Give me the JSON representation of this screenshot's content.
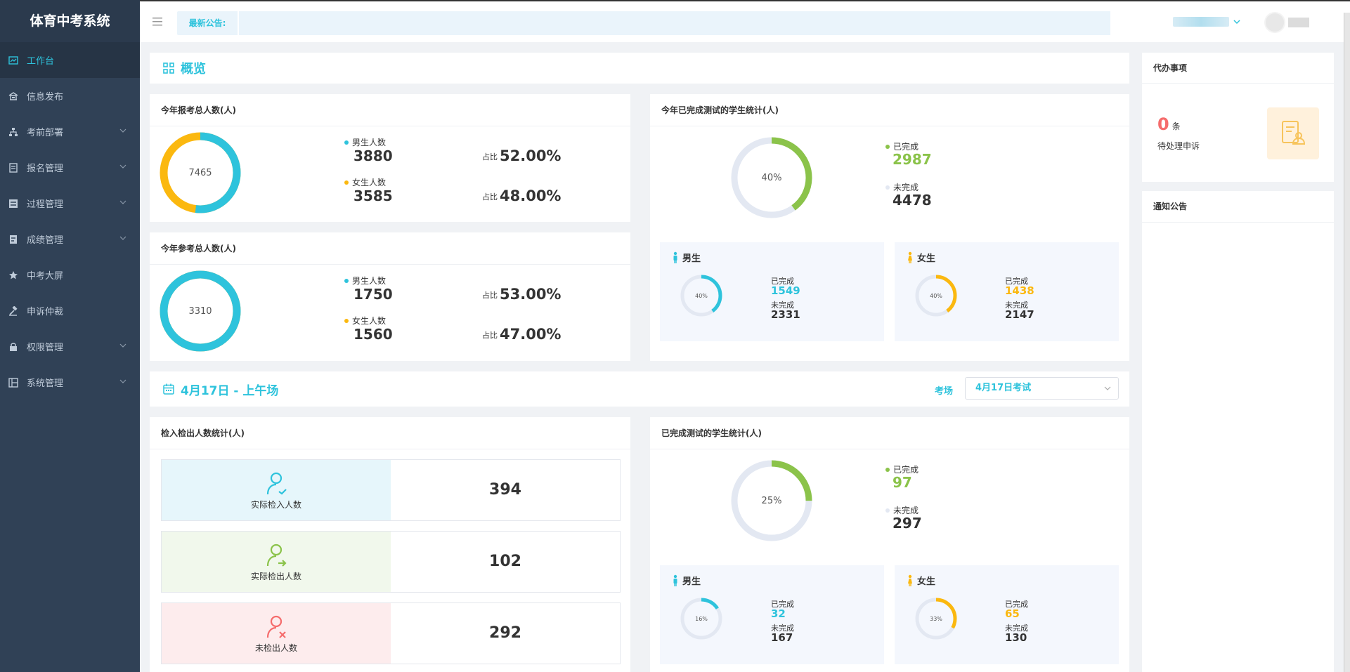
{
  "app": {
    "title": "体育中考系统"
  },
  "sidebar": {
    "items": [
      {
        "label": "工作台",
        "icon": "dashboard-icon",
        "active": true,
        "expandable": false
      },
      {
        "label": "信息发布",
        "icon": "building-icon",
        "active": false,
        "expandable": false
      },
      {
        "label": "考前部署",
        "icon": "sitemap-icon",
        "active": false,
        "expandable": true
      },
      {
        "label": "报名管理",
        "icon": "document-icon",
        "active": false,
        "expandable": true
      },
      {
        "label": "过程管理",
        "icon": "list-icon",
        "active": false,
        "expandable": true
      },
      {
        "label": "成绩管理",
        "icon": "score-icon",
        "active": false,
        "expandable": true
      },
      {
        "label": "中考大屏",
        "icon": "star-icon",
        "active": false,
        "expandable": false
      },
      {
        "label": "申诉仲裁",
        "icon": "gavel-icon",
        "active": false,
        "expandable": false
      },
      {
        "label": "权限管理",
        "icon": "lock-icon",
        "active": false,
        "expandable": true
      },
      {
        "label": "系统管理",
        "icon": "grid-icon",
        "active": false,
        "expandable": true
      }
    ]
  },
  "topbar": {
    "notice_label": "最新公告:",
    "notice_value": ""
  },
  "overview": {
    "title": "概览"
  },
  "registered": {
    "title": "今年报考总人数(人)",
    "total": "7465",
    "male_label": "男生人数",
    "male_value": "3880",
    "female_label": "女生人数",
    "female_value": "3585",
    "ratio_label": "占比",
    "male_ratio": "52.00%",
    "female_ratio": "48.00%",
    "male_fraction": 0.52
  },
  "participating": {
    "title": "今年参考总人数(人)",
    "total": "3310",
    "male_label": "男生人数",
    "male_value": "1750",
    "female_label": "女生人数",
    "female_value": "1560",
    "ratio_label": "占比",
    "male_ratio": "53.00%",
    "female_ratio": "47.00%",
    "male_fraction": 1.0
  },
  "year_completed": {
    "title": "今年已完成测试的学生统计(人)",
    "percent_label": "40%",
    "fraction": 0.4,
    "done_label": "已完成",
    "done_value": "2987",
    "undone_label": "未完成",
    "undone_value": "4478",
    "male": {
      "title": "男生",
      "percent_label": "40%",
      "fraction": 0.4,
      "done_label": "已完成",
      "done_value": "1549",
      "undone_label": "未完成",
      "undone_value": "2331"
    },
    "female": {
      "title": "女生",
      "percent_label": "40%",
      "fraction": 0.4,
      "done_label": "已完成",
      "done_value": "1438",
      "undone_label": "未完成",
      "undone_value": "2147"
    }
  },
  "session": {
    "title": "4月17日 - 上午场",
    "venue_label": "考场",
    "venue_value": "4月17日考试"
  },
  "checkin": {
    "title": "检入检出人数统计(人)",
    "rows": [
      {
        "label": "实际检入人数",
        "value": "394",
        "icon": "user-checkin-icon",
        "color": "#2ec3dc",
        "bg": "#e6f6fb"
      },
      {
        "label": "实际检出人数",
        "value": "102",
        "icon": "user-checkout-icon",
        "color": "#8bc34a",
        "bg": "#f1f8ec"
      },
      {
        "label": "未检出人数",
        "value": "292",
        "icon": "user-missing-icon",
        "color": "#f56c6c",
        "bg": "#fdeced"
      }
    ]
  },
  "session_completed": {
    "title": "已完成测试的学生统计(人)",
    "percent_label": "25%",
    "fraction": 0.25,
    "done_label": "已完成",
    "done_value": "97",
    "undone_label": "未完成",
    "undone_value": "297",
    "male": {
      "title": "男生",
      "percent_label": "16%",
      "fraction": 0.16,
      "done_label": "已完成",
      "done_value": "32",
      "undone_label": "未完成",
      "undone_value": "167"
    },
    "female": {
      "title": "女生",
      "percent_label": "33%",
      "fraction": 0.33,
      "done_label": "已完成",
      "done_value": "65",
      "undone_label": "未完成",
      "undone_value": "130"
    }
  },
  "todo": {
    "title": "代办事项",
    "count": "0",
    "unit": "条",
    "desc": "待处理申诉"
  },
  "announcements": {
    "title": "通知公告"
  },
  "colors": {
    "accent": "#2ec3dc",
    "female": "#fbb80f",
    "done": "#8bc34a",
    "track": "#e3e8f2",
    "danger": "#f56c6c"
  }
}
